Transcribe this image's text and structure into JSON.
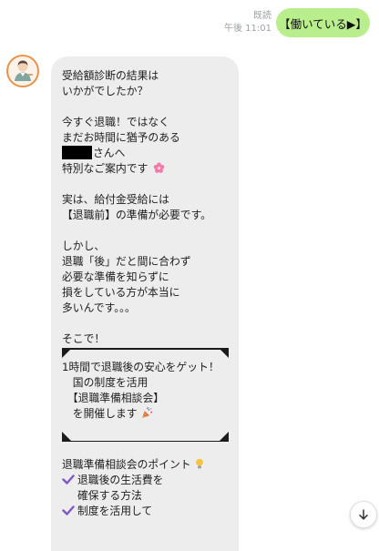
{
  "outgoing": {
    "read_label": "既読",
    "time": "午後 11:01",
    "text": "【働いている▶】"
  },
  "incoming": {
    "sender_avatar_icon": "person-avatar-icon",
    "lines_1": [
      "受給額診断の結果は",
      "いかがでしたか？"
    ],
    "lines_2": [
      "今すぐ退職！ではなく",
      "まだお時間に猶予のある"
    ],
    "name_suffix": "さんへ",
    "special_line": "特別なご案内です",
    "lines_3": [
      "実は、給付金受給には",
      "【退職前】の準備が必要です。"
    ],
    "lines_4": [
      "しかし、",
      "退職「後」だと間に合わず",
      "必要な準備を知らずに",
      "損をしている方が本当に",
      "多いんです。。。"
    ],
    "line_5": "そこで！",
    "box_lines": [
      "1時間で退職後の安心をゲット！",
      "　国の制度を活用",
      "　【退職準備相談会】",
      "　を開催します"
    ],
    "points_title": "退職準備相談会のポイント",
    "point_1a": "退職後の生活費を",
    "point_1b": "確保する方法",
    "point_2": "制度を活用して"
  },
  "colors": {
    "outgoing_bubble": "#b9ee8c",
    "incoming_bubble": "#ededed",
    "check_mark": "#7e57c2"
  },
  "icons": {
    "flower": "cherry-blossom-icon",
    "bulb": "light-bulb-icon",
    "party": "party-popper-icon",
    "check": "check-mark-icon",
    "scroll": "arrow-down-icon"
  }
}
